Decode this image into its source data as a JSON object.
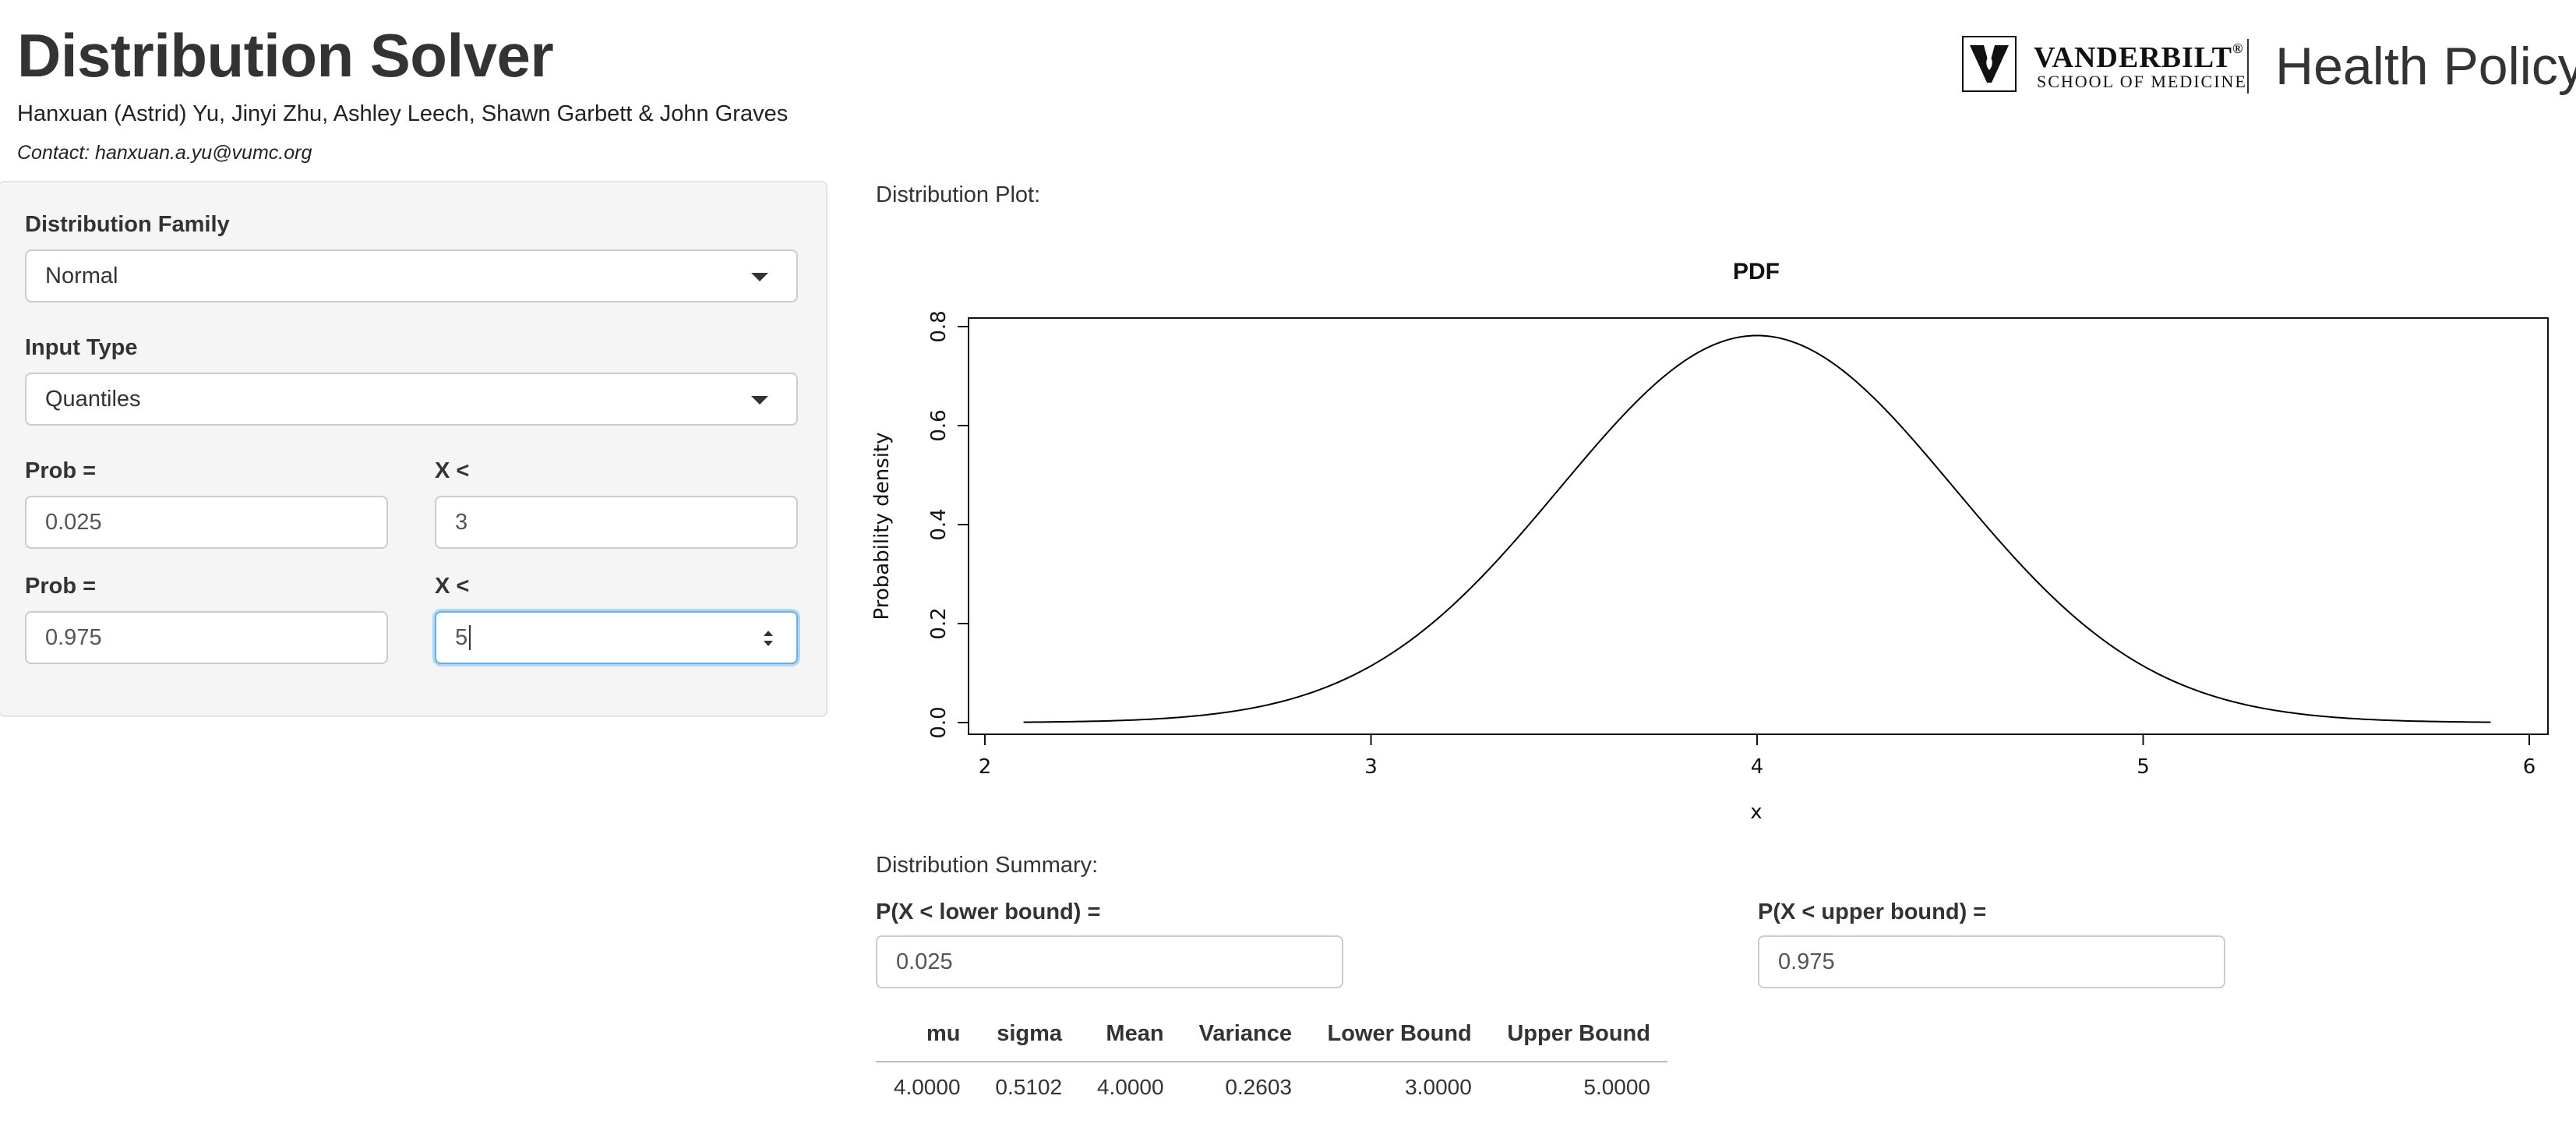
{
  "header": {
    "title": "Distribution Solver",
    "authors": "Hanxuan (Astrid) Yu, Jinyi Zhu, Ashley Leech, Shawn Garbett & John Graves",
    "contact": "Contact: hanxuan.a.yu@vumc.org",
    "logo": {
      "name": "VANDERBILT",
      "mark": "®",
      "school": "SCHOOL OF MEDICINE",
      "department": "Health Policy"
    }
  },
  "sidebar": {
    "family_label": "Distribution Family",
    "family_value": "Normal",
    "input_type_label": "Input Type",
    "input_type_value": "Quantiles",
    "rows": [
      {
        "prob_label": "Prob =",
        "prob_value": "0.025",
        "x_label": "X <",
        "x_value": "3"
      },
      {
        "prob_label": "Prob =",
        "prob_value": "0.975",
        "x_label": "X <",
        "x_value": "5"
      }
    ]
  },
  "main": {
    "plot_label": "Distribution Plot:",
    "summary_label": "Distribution Summary:",
    "lower_label": "P(X < lower bound) =",
    "lower_value": "0.025",
    "upper_label": "P(X < upper bound) =",
    "upper_value": "0.975",
    "table": {
      "headers": [
        "mu",
        "sigma",
        "Mean",
        "Variance",
        "Lower Bound",
        "Upper Bound"
      ],
      "row": [
        "4.0000",
        "0.5102",
        "4.0000",
        "0.2603",
        "3.0000",
        "5.0000"
      ]
    }
  },
  "chart_data": {
    "type": "line",
    "title": "PDF",
    "xlabel": "x",
    "ylabel": "Probability density",
    "xlim": [
      2,
      6
    ],
    "ylim": [
      0,
      0.8
    ],
    "xticks": [
      "2",
      "3",
      "4",
      "5",
      "6"
    ],
    "yticks": [
      "0.0",
      "0.2",
      "0.4",
      "0.6",
      "0.8"
    ],
    "grid": false,
    "series": [
      {
        "distribution": "normal",
        "mu": 4.0,
        "sigma": 0.5102,
        "x_range": [
          2.1,
          5.9
        ],
        "color": "#000000"
      }
    ]
  }
}
